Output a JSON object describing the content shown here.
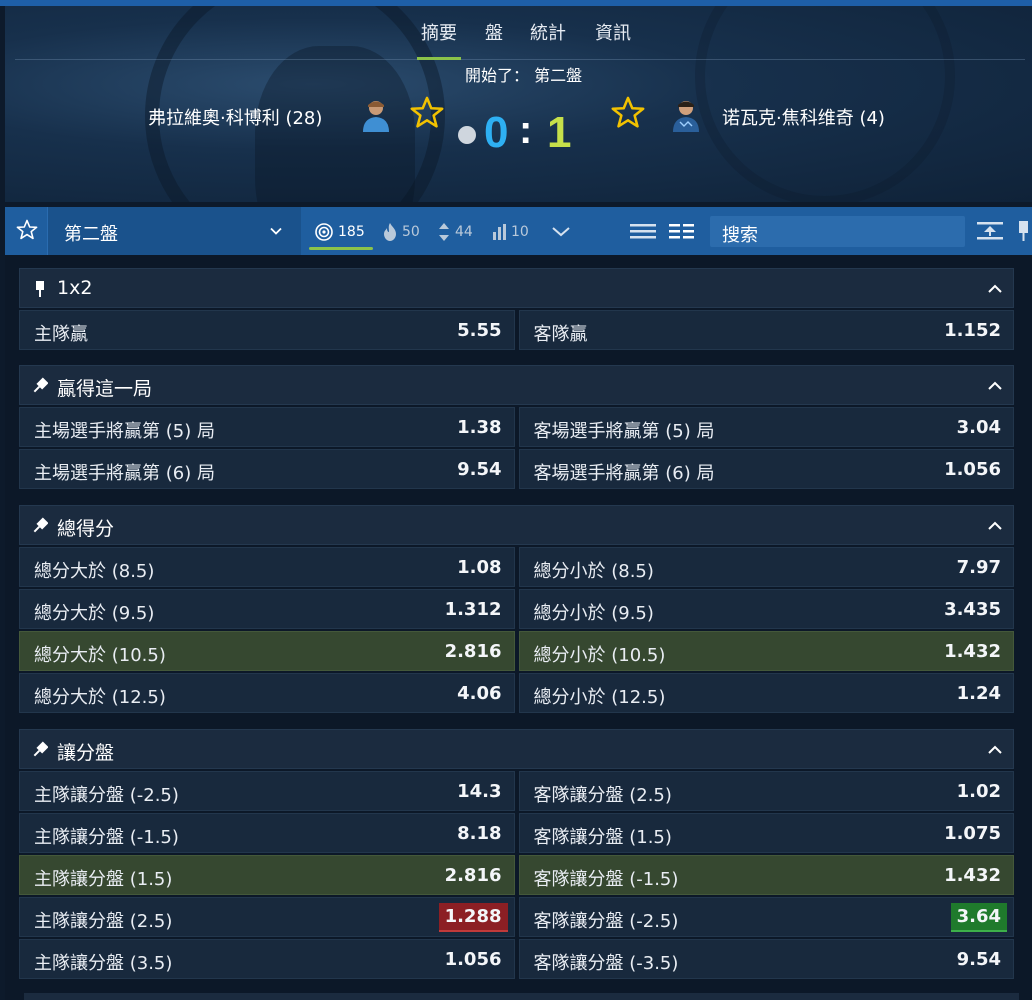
{
  "colors": {
    "accent_green": "#8bc34a",
    "toolbar_blue": "#1f5e9f",
    "score_home": "#2eb0f3",
    "score_away": "#c6e04a",
    "star_yellow": "#f2c200",
    "odds_down": "#8c1f24",
    "odds_up": "#1f7a2c",
    "highlight_row": "#364830"
  },
  "hero": {
    "tabs": [
      {
        "label": "摘要",
        "active": true
      },
      {
        "label": "盤",
        "active": false
      },
      {
        "label": "統計",
        "active": false
      },
      {
        "label": "資訊",
        "active": false
      }
    ],
    "status": "開始了： 第二盤",
    "home_player": "弗拉維奧·科博利 (28)",
    "away_player": "诺瓦克·焦科维奇 (4)",
    "score_home": "0",
    "score_separator": ":",
    "score_away": "1",
    "serving_icon": "tennis-ball-icon"
  },
  "toolbar": {
    "period": "第二盤",
    "filters": [
      {
        "icon": "target-icon",
        "count": "185",
        "active": true
      },
      {
        "icon": "fire-icon",
        "count": "50",
        "active": false
      },
      {
        "icon": "updown-arrows-icon",
        "count": "44",
        "active": false
      },
      {
        "icon": "bar-chart-icon",
        "count": "10",
        "active": false
      }
    ],
    "search_placeholder": "搜索"
  },
  "markets": [
    {
      "title": "1x2",
      "rows": [
        {
          "left": {
            "label": "主隊贏",
            "odds": "5.55"
          },
          "right": {
            "label": "客隊贏",
            "odds": "1.152"
          }
        }
      ]
    },
    {
      "title": "贏得這一局",
      "rows": [
        {
          "left": {
            "label": "主場選手將贏第 (5) 局",
            "odds": "1.38"
          },
          "right": {
            "label": "客場選手將贏第 (5) 局",
            "odds": "3.04"
          }
        },
        {
          "left": {
            "label": "主場選手將贏第 (6) 局",
            "odds": "9.54"
          },
          "right": {
            "label": "客場選手將贏第 (6) 局",
            "odds": "1.056"
          }
        }
      ]
    },
    {
      "title": "總得分",
      "rows": [
        {
          "left": {
            "label": "總分大於 (8.5)",
            "odds": "1.08"
          },
          "right": {
            "label": "總分小於 (8.5)",
            "odds": "7.97"
          }
        },
        {
          "left": {
            "label": "總分大於 (9.5)",
            "odds": "1.312"
          },
          "right": {
            "label": "總分小於 (9.5)",
            "odds": "3.435"
          }
        },
        {
          "left": {
            "label": "總分大於 (10.5)",
            "odds": "2.816"
          },
          "right": {
            "label": "總分小於 (10.5)",
            "odds": "1.432"
          },
          "highlight": true
        },
        {
          "left": {
            "label": "總分大於 (12.5)",
            "odds": "4.06"
          },
          "right": {
            "label": "總分小於 (12.5)",
            "odds": "1.24"
          }
        }
      ]
    },
    {
      "title": "讓分盤",
      "rows": [
        {
          "left": {
            "label": "主隊讓分盤 (-2.5)",
            "odds": "14.3"
          },
          "right": {
            "label": "客隊讓分盤 (2.5)",
            "odds": "1.02"
          }
        },
        {
          "left": {
            "label": "主隊讓分盤 (-1.5)",
            "odds": "8.18"
          },
          "right": {
            "label": "客隊讓分盤 (1.5)",
            "odds": "1.075"
          }
        },
        {
          "left": {
            "label": "主隊讓分盤 (1.5)",
            "odds": "2.816"
          },
          "right": {
            "label": "客隊讓分盤 (-1.5)",
            "odds": "1.432"
          },
          "highlight": true
        },
        {
          "left": {
            "label": "主隊讓分盤 (2.5)",
            "odds": "1.288",
            "trend": "down"
          },
          "right": {
            "label": "客隊讓分盤 (-2.5)",
            "odds": "3.64",
            "trend": "up"
          }
        },
        {
          "left": {
            "label": "主隊讓分盤 (3.5)",
            "odds": "1.056"
          },
          "right": {
            "label": "客隊讓分盤 (-3.5)",
            "odds": "9.54"
          }
        }
      ]
    }
  ]
}
